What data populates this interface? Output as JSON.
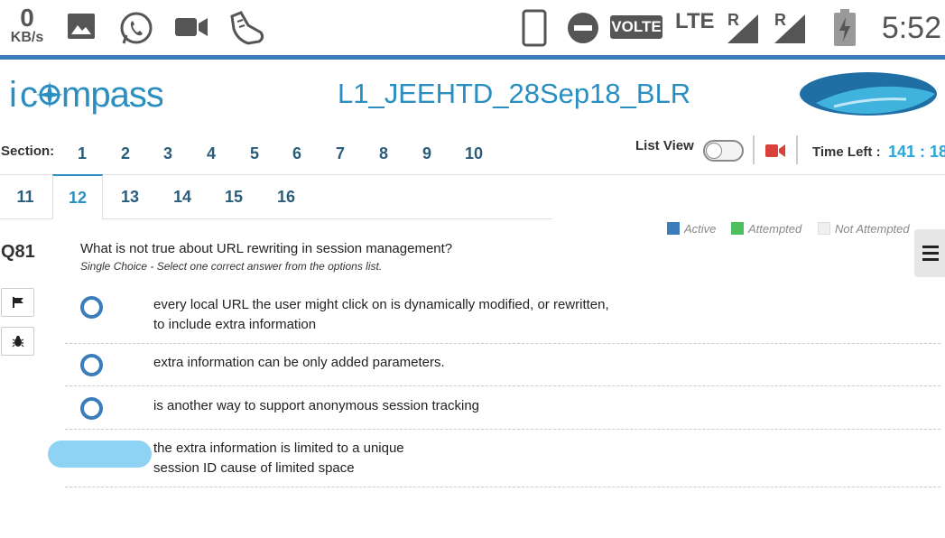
{
  "status_bar": {
    "data_speed_value": "0",
    "data_speed_unit": "KB/s",
    "network_badge": "VOLTE",
    "network_type": "LTE",
    "roaming_1": "R",
    "roaming_2": "R",
    "clock": "5:52",
    "icons": [
      "gallery-icon",
      "whatsapp-icon",
      "video-camera-icon",
      "fitness-shoe-icon",
      "phone-icon",
      "do-not-disturb-icon",
      "signal-icon",
      "battery-charging-icon"
    ]
  },
  "header": {
    "logo_text": "icompass",
    "exam_title": "L1_JEEHTD_28Sep18_BLR"
  },
  "sections": {
    "label": "Section:",
    "row1": [
      "1",
      "2",
      "3",
      "4",
      "5",
      "6",
      "7",
      "8",
      "9",
      "10"
    ],
    "row2": [
      "11",
      "12",
      "13",
      "14",
      "15",
      "16"
    ],
    "active": "12"
  },
  "controls": {
    "list_view_label": "List View",
    "list_view_on": false,
    "time_left_label": "Time Left :",
    "time_left_value": "141 : 18"
  },
  "legend": {
    "active": "Active",
    "attempted": "Attempted",
    "not_attempted": "Not Attempted",
    "colors": {
      "active": "#3b7db8",
      "attempted": "#4cbf5e",
      "not_attempted": "#f0f0f0"
    }
  },
  "question": {
    "number": "Q81",
    "text": "What is not true about URL rewriting in session management?",
    "type_hint": "Single Choice - Select one correct answer from the options list.",
    "options": [
      {
        "line1": "every local URL the user might click on is dynamically modified, or rewritten,",
        "line2": "to include extra information"
      },
      {
        "line1": "extra information can be only added parameters.",
        "line2": ""
      },
      {
        "line1": "is another way to support anonymous session tracking",
        "line2": ""
      },
      {
        "line1": "the extra information is limited to a unique",
        "line2": "session ID cause of limited space"
      }
    ]
  }
}
